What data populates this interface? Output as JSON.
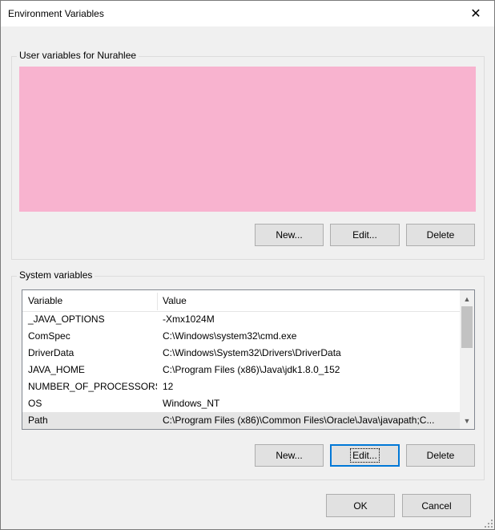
{
  "window": {
    "title": "Environment Variables",
    "close_icon": "✕"
  },
  "user_section": {
    "label": "User variables for Nurahlee",
    "redacted_color": "#f8b3cf",
    "buttons": {
      "new": "New...",
      "edit": "Edit...",
      "delete": "Delete"
    }
  },
  "system_section": {
    "label": "System variables",
    "columns": {
      "name": "Variable",
      "value": "Value"
    },
    "rows": [
      {
        "name": "_JAVA_OPTIONS",
        "value": "-Xmx1024M"
      },
      {
        "name": "ComSpec",
        "value": "C:\\Windows\\system32\\cmd.exe"
      },
      {
        "name": "DriverData",
        "value": "C:\\Windows\\System32\\Drivers\\DriverData"
      },
      {
        "name": "JAVA_HOME",
        "value": "C:\\Program Files (x86)\\Java\\jdk1.8.0_152"
      },
      {
        "name": "NUMBER_OF_PROCESSORS",
        "value": "12"
      },
      {
        "name": "OS",
        "value": "Windows_NT"
      },
      {
        "name": "Path",
        "value": "C:\\Program Files (x86)\\Common Files\\Oracle\\Java\\javapath;C..."
      }
    ],
    "scroll_up_icon": "▲",
    "scroll_down_icon": "▼",
    "buttons": {
      "new": "New...",
      "edit": "Edit...",
      "delete": "Delete"
    }
  },
  "footer": {
    "ok": "OK",
    "cancel": "Cancel"
  }
}
